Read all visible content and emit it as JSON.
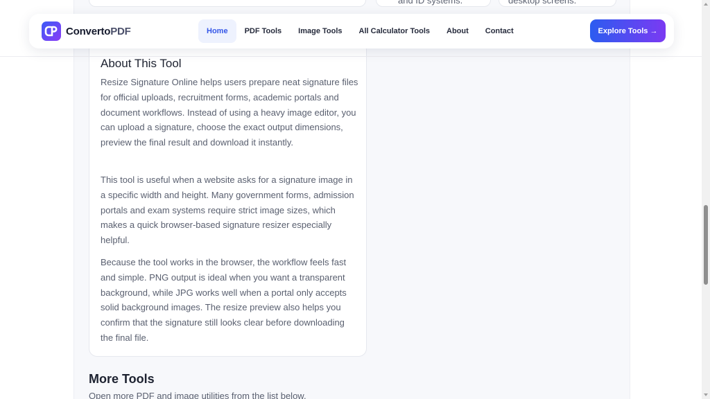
{
  "peek": {
    "card2_text": "and ID systems.",
    "card3_text": "desktop screens."
  },
  "header": {
    "logo_icon": "converto-logo-icon",
    "logo_brand": "Converto",
    "logo_suffix": "PDF",
    "nav": [
      {
        "label": "Home",
        "active": true
      },
      {
        "label": "PDF Tools",
        "active": false
      },
      {
        "label": "Image Tools",
        "active": false
      },
      {
        "label": "All Calculator Tools",
        "active": false
      },
      {
        "label": "About",
        "active": false
      },
      {
        "label": "Contact",
        "active": false
      }
    ],
    "cta_label": "Explore Tools →"
  },
  "about": {
    "title": "About This Tool",
    "paragraphs": [
      "Resize Signature Online helps users prepare neat signature files for official uploads, recruitment forms, academic portals and document workflows. Instead of using a heavy image editor, you can upload a signature, choose the exact output dimensions, preview the final result and download it instantly.",
      "This tool is useful when a website asks for a signature image in a specific width and height. Many government forms, admission portals and exam systems require strict image sizes, which makes a quick browser-based signature resizer especially helpful.",
      "Because the tool works in the browser, the workflow feels fast and simple. PNG output is ideal when you want a transparent background, while JPG works well when a portal only accepts solid background images. The resize preview also helps you confirm that the signature still looks clear before downloading the final file."
    ]
  },
  "more_tools": {
    "title": "More Tools",
    "subtitle": "Open more PDF and image utilities from the list below."
  },
  "colors": {
    "accent": "#3557e8",
    "cta_start": "#2c5cf0",
    "cta_end": "#7b3af2"
  }
}
